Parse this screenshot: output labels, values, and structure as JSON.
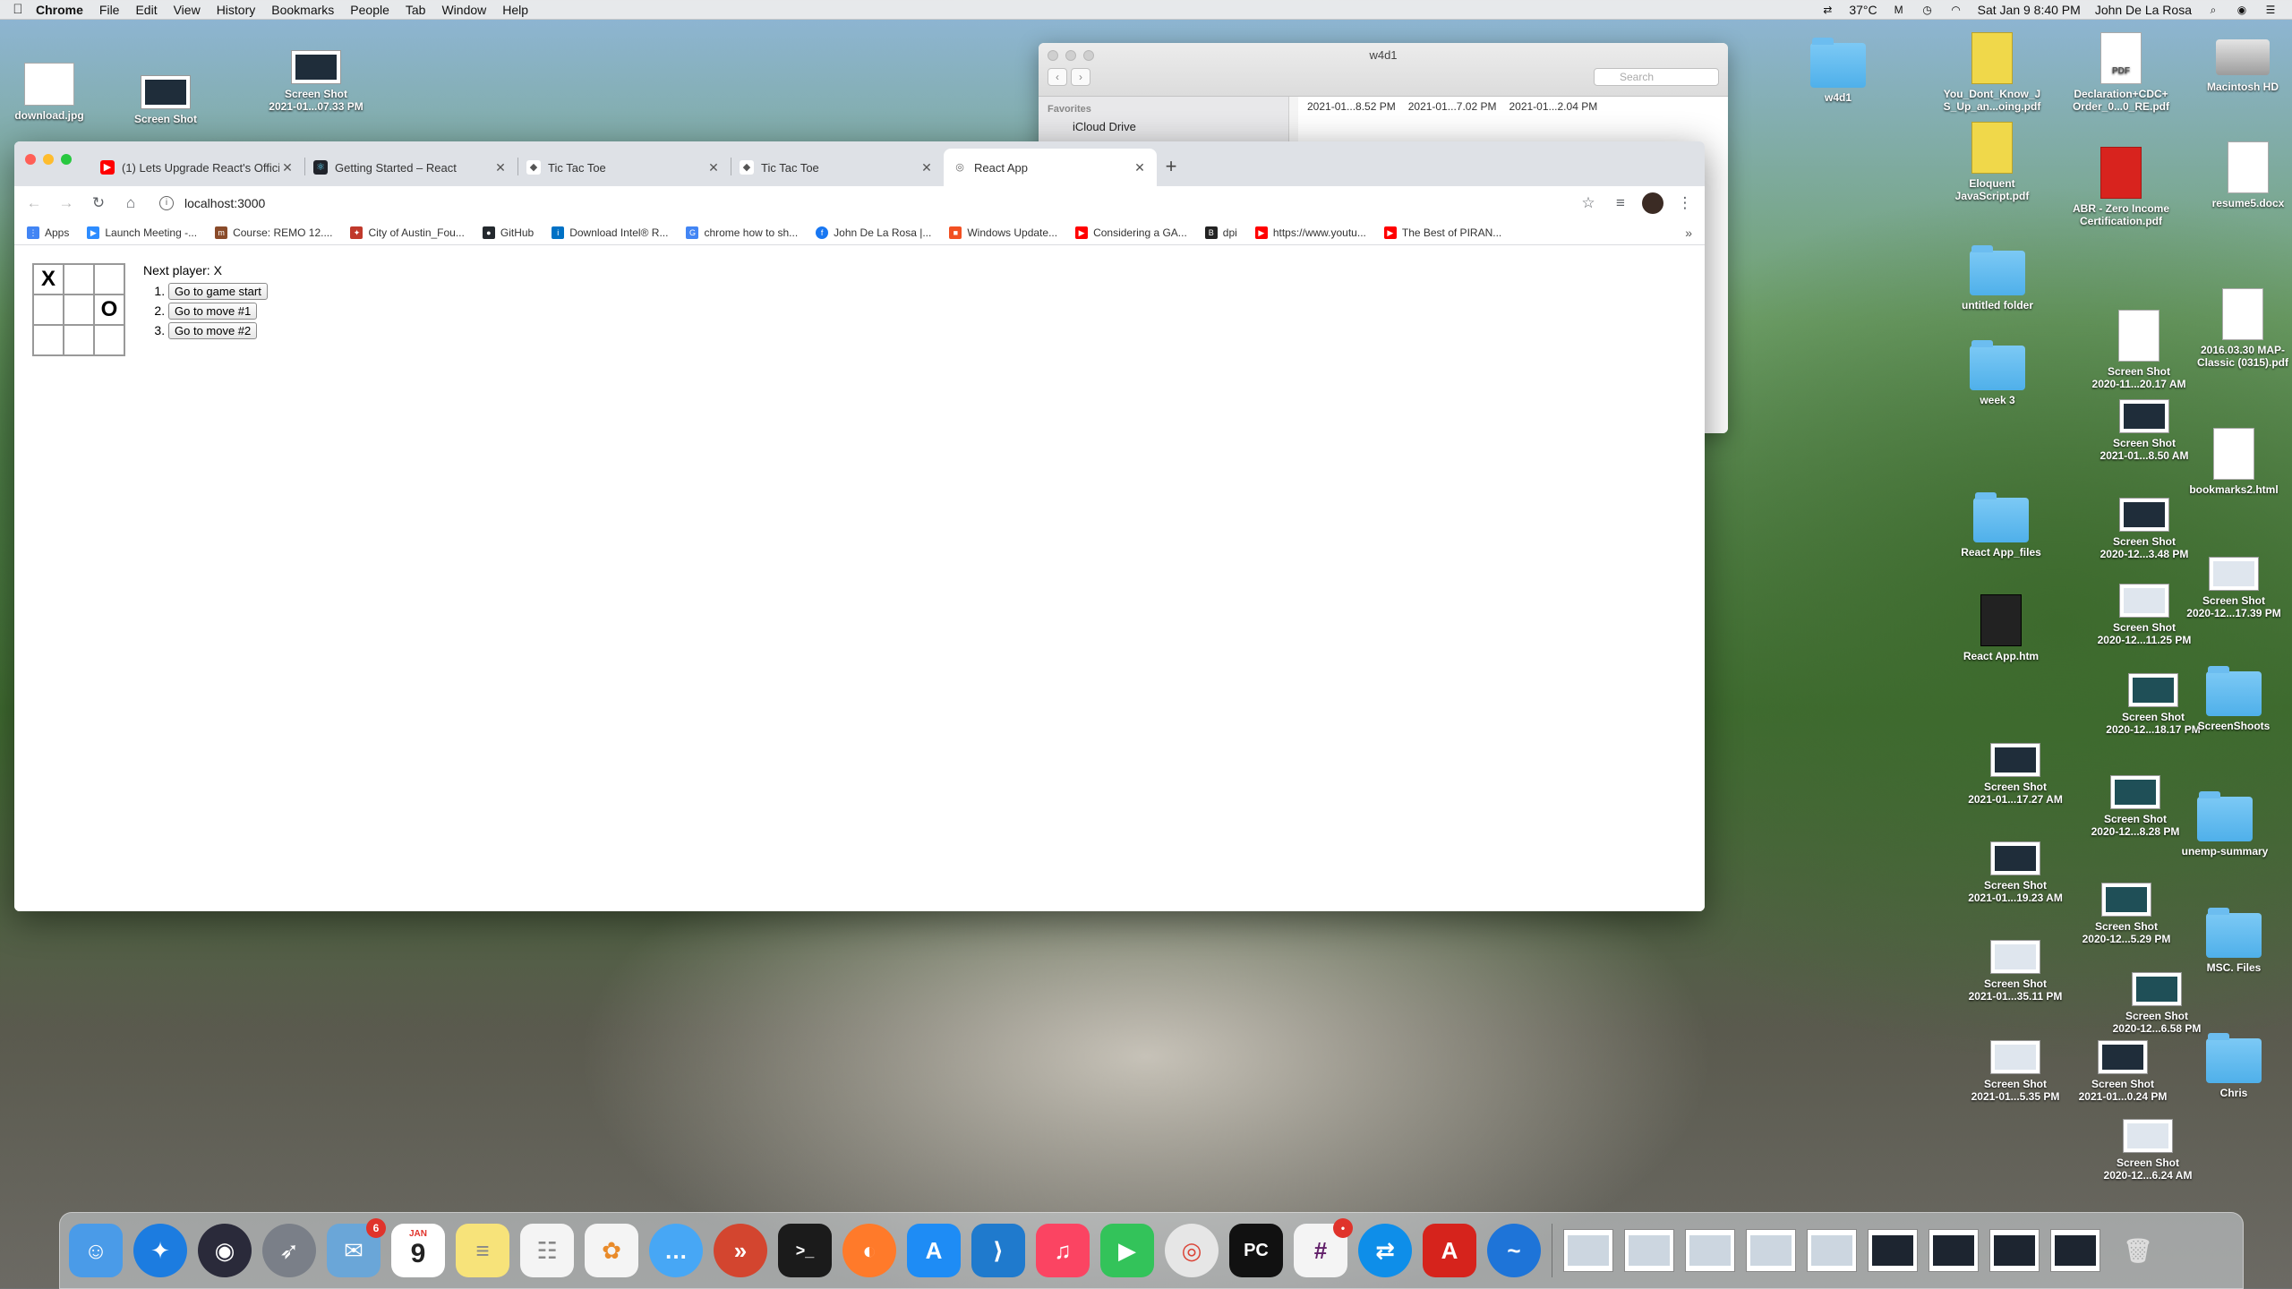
{
  "menubar": {
    "app": "Chrome",
    "items": [
      "File",
      "Edit",
      "View",
      "History",
      "Bookmarks",
      "People",
      "Tab",
      "Window",
      "Help"
    ],
    "temperature": "37°C",
    "datetime": "Sat Jan 9  8:40 PM",
    "user": "John De La Rosa"
  },
  "finder": {
    "title": "w4d1",
    "search_placeholder": "Search",
    "sidebar_header": "Favorites",
    "sidebar_item": "iCloud Drive",
    "files": [
      "2021-01...8.52 PM",
      "2021-01...7.02 PM",
      "2021-01...2.04 PM"
    ]
  },
  "desktop_left": [
    {
      "label": "download.jpg"
    },
    {
      "label": "Screen Shot"
    },
    {
      "label": "Screen Shot\n2021-01...07.33 PM"
    }
  ],
  "desktop_right": [
    {
      "label": "w4d1"
    },
    {
      "label": "You_Dont_Know_J\nS_Up_an...oing.pdf"
    },
    {
      "label": "Declaration+CDC+\nOrder_0...0_RE.pdf"
    },
    {
      "label": "Macintosh HD"
    },
    {
      "label": "Eloquent\nJavaScript.pdf"
    },
    {
      "label": "ABR - Zero Income\nCertification.pdf"
    },
    {
      "label": "resume5.docx"
    },
    {
      "label": "untitled folder"
    },
    {
      "label": "Screen Shot\n2020-11...20.17 AM"
    },
    {
      "label": "2016.03.30 MAP-\nClassic (0315).pdf"
    },
    {
      "label": "week 3"
    },
    {
      "label": "Screen Shot\n2021-01...8.50 AM"
    },
    {
      "label": "bookmarks2.html"
    },
    {
      "label": "React App_files"
    },
    {
      "label": "Screen Shot\n2020-12...3.48 PM"
    },
    {
      "label": "Screen Shot\n2020-12...17.39 PM"
    },
    {
      "label": "React App.htm"
    },
    {
      "label": "Screen Shot\n2020-12...11.25 PM"
    },
    {
      "label": "Screen Shot\n2020-12...18.17 PM"
    },
    {
      "label": "ScreenShoots"
    },
    {
      "label": "Screen Shot\n2021-01...17.27 AM"
    },
    {
      "label": "Screen Shot\n2020-12...8.28 PM"
    },
    {
      "label": "unemp-summary"
    },
    {
      "label": "Screen Shot\n2021-01...19.23 AM"
    },
    {
      "label": "Screen Shot\n2020-12...5.29 PM"
    },
    {
      "label": "MSC. Files"
    },
    {
      "label": "Screen Shot\n2021-01...35.11 PM"
    },
    {
      "label": "Screen Shot\n2020-12...6.58 PM"
    },
    {
      "label": "Screen Shot\n2021-01...5.35 PM"
    },
    {
      "label": "Screen Shot\n2021-01...0.24 PM"
    },
    {
      "label": "Chris"
    },
    {
      "label": "Screen Shot\n2020-12...6.24 AM"
    }
  ],
  "chrome": {
    "tabs": [
      {
        "label": "(1) Lets Upgrade React's Offici",
        "fav_color": "#ff0000",
        "fav": "▶"
      },
      {
        "label": "Getting Started – React",
        "fav_color": "#20232a",
        "fav": "⚛"
      },
      {
        "label": "Tic Tac Toe",
        "fav_color": "#555555",
        "fav": "◆"
      },
      {
        "label": "Tic Tac Toe",
        "fav_color": "#555555",
        "fav": "◆"
      },
      {
        "label": "React App",
        "fav_color": "#777777",
        "fav": "◎"
      }
    ],
    "url": "localhost:3000",
    "bookmarks": [
      {
        "label": "Apps",
        "color": "#4285f4"
      },
      {
        "label": "Launch Meeting -...",
        "color": "#2d8cff"
      },
      {
        "label": "Course: REMO 12....",
        "color": "#8a4b2a"
      },
      {
        "label": "City of Austin_Fou...",
        "color": "#c0392b"
      },
      {
        "label": "GitHub",
        "color": "#24292e"
      },
      {
        "label": "Download Intel® R...",
        "color": "#0071c5"
      },
      {
        "label": "chrome how to sh...",
        "color": "#4285f4"
      },
      {
        "label": "John De La Rosa |...",
        "color": "#1877f2"
      },
      {
        "label": "Windows Update...",
        "color": "#f25022"
      },
      {
        "label": "Considering a GA...",
        "color": "#ff0000"
      },
      {
        "label": "dpi",
        "color": "#222222"
      },
      {
        "label": "https://www.youtu...",
        "color": "#ff0000"
      },
      {
        "label": "The Best of PIRAN...",
        "color": "#ff0000"
      }
    ],
    "more": "»"
  },
  "game": {
    "board": [
      "X",
      "",
      "",
      "",
      "",
      "O",
      "",
      "",
      ""
    ],
    "status": "Next player: X",
    "moves": [
      "Go to game start",
      "Go to move #1",
      "Go to move #2"
    ]
  },
  "dock": {
    "apps": [
      {
        "name": "finder-app",
        "color": "#4a9be8"
      },
      {
        "name": "safari-app",
        "color": "#1c7ce0"
      },
      {
        "name": "siri-app",
        "color": "#2a2a3a"
      },
      {
        "name": "launchpad-app",
        "color": "#7a7f88"
      },
      {
        "name": "mail-app",
        "color": "#6aa6d8",
        "badge": "6"
      },
      {
        "name": "calendar-app",
        "color": "#ffffff",
        "month": "JAN",
        "day": "9"
      },
      {
        "name": "notes-app",
        "color": "#f7e37a"
      },
      {
        "name": "reminders-app",
        "color": "#f4f4f4"
      },
      {
        "name": "photos-app",
        "color": "#f4f4f4"
      },
      {
        "name": "messages-app",
        "color": "#47a7f5"
      },
      {
        "name": "remote-desktop-app",
        "color": "#d3452f"
      },
      {
        "name": "terminal-app",
        "color": "#1b1b1b"
      },
      {
        "name": "firefox-app",
        "color": "#ff7a2a"
      },
      {
        "name": "app-store-app",
        "color": "#1e8cf5"
      },
      {
        "name": "vscode-app",
        "color": "#1f7acd"
      },
      {
        "name": "music-app",
        "color": "#fb4462"
      },
      {
        "name": "facetime-app",
        "color": "#33c35a"
      },
      {
        "name": "chrome-app",
        "color": "#e6e6e6"
      },
      {
        "name": "pycharm-app",
        "color": "#111111"
      },
      {
        "name": "slack-app",
        "color": "#f4f4f4",
        "badge": "•"
      },
      {
        "name": "teamviewer-app",
        "color": "#0e8ee9"
      },
      {
        "name": "acrobat-app",
        "color": "#d6231c"
      },
      {
        "name": "pdf-expert-app",
        "color": "#1e74d8"
      }
    ]
  }
}
